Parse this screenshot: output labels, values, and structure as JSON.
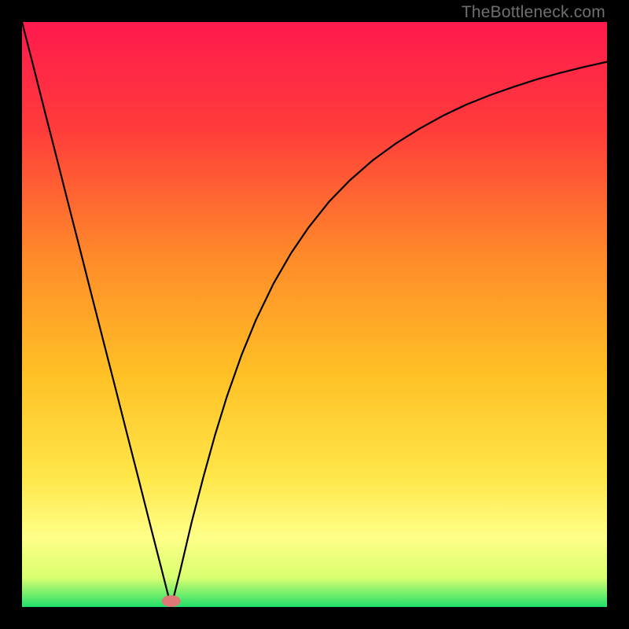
{
  "watermark": "TheBottleneck.com",
  "chart_data": {
    "type": "line",
    "title": "",
    "xlabel": "",
    "ylabel": "",
    "xlim": [
      0,
      100
    ],
    "ylim": [
      0,
      100
    ],
    "gradient_stops": [
      {
        "offset": 0.0,
        "color": "#ff1a4d"
      },
      {
        "offset": 0.18,
        "color": "#ff3b3b"
      },
      {
        "offset": 0.4,
        "color": "#ff8a2a"
      },
      {
        "offset": 0.6,
        "color": "#ffc025"
      },
      {
        "offset": 0.78,
        "color": "#ffe74a"
      },
      {
        "offset": 0.88,
        "color": "#ffff87"
      },
      {
        "offset": 0.95,
        "color": "#d9ff70"
      },
      {
        "offset": 1.0,
        "color": "#21e06a"
      }
    ],
    "marker": {
      "x": 25.5,
      "y": 1.0,
      "color": "#e07878",
      "rx": 1.6,
      "ry": 1.0
    },
    "series": [
      {
        "name": "curve",
        "x": [
          0.0,
          2.0,
          4.0,
          6.0,
          8.0,
          10.0,
          12.0,
          14.0,
          16.0,
          18.0,
          20.0,
          22.0,
          24.0,
          25.5,
          27.0,
          29.0,
          31.0,
          33.0,
          35.0,
          37.5,
          40.0,
          43.0,
          46.0,
          49.0,
          52.5,
          56.0,
          60.0,
          64.0,
          68.0,
          72.0,
          76.0,
          80.0,
          84.0,
          88.0,
          92.0,
          96.0,
          100.0
        ],
        "values": [
          100.0,
          92.2,
          84.3,
          76.5,
          68.6,
          60.8,
          52.9,
          45.1,
          37.3,
          29.4,
          21.6,
          13.7,
          5.9,
          0.0,
          6.0,
          14.5,
          22.2,
          29.4,
          35.9,
          43.0,
          49.1,
          55.3,
          60.5,
          64.9,
          69.3,
          72.9,
          76.4,
          79.3,
          81.8,
          84.0,
          85.9,
          87.5,
          88.9,
          90.2,
          91.3,
          92.3,
          93.2
        ]
      }
    ]
  }
}
